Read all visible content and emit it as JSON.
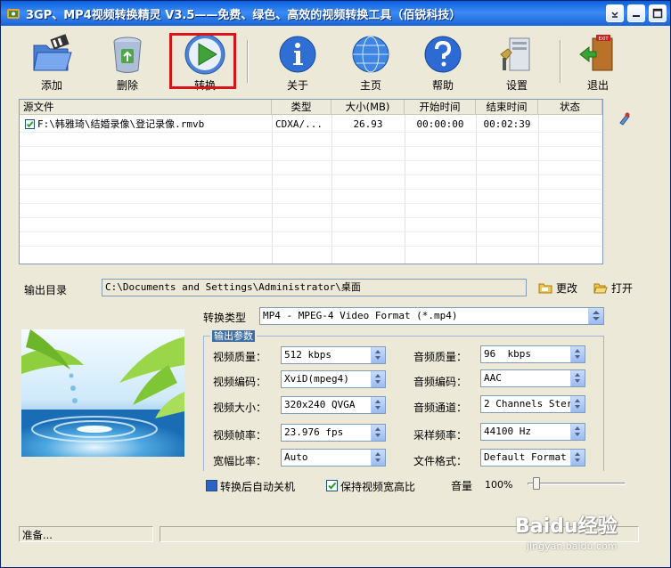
{
  "window": {
    "title": "3GP、MP4视频转换精灵 V3.5——免费、绿色、高效的视频转换工具（佰锐科技）"
  },
  "toolbar": {
    "add": "添加",
    "delete": "删除",
    "convert": "转换",
    "about": "关于",
    "home": "主页",
    "help": "帮助",
    "settings": "设置",
    "exit": "退出"
  },
  "file_table": {
    "headers": [
      "源文件",
      "类型",
      "大小(MB)",
      "开始时间",
      "结束时间",
      "状态"
    ],
    "rows": [
      {
        "checked": true,
        "source": "F:\\韩雅琦\\结婚录像\\登记录像.rmvb",
        "type": "CDXA/...",
        "size": "26.93",
        "start": "00:00:00",
        "end": "00:02:39",
        "status": ""
      }
    ]
  },
  "output": {
    "label": "输出目录",
    "path": "C:\\Documents and Settings\\Administrator\\桌面",
    "change_label": "更改",
    "open_label": "打开"
  },
  "conversion": {
    "type_label": "转换类型",
    "type_value": "MP4 - MPEG-4 Video Format (*.mp4)",
    "group_title": "输出参数",
    "video_quality_label": "视频质量：",
    "video_quality": "512 kbps",
    "video_codec_label": "视频编码：",
    "video_codec": "XviD(mpeg4)",
    "video_size_label": "视频大小：",
    "video_size": "320x240 QVGA",
    "frame_rate_label": "视频帧率：",
    "frame_rate": "23.976 fps",
    "aspect_label": "宽幅比率：",
    "aspect": "Auto",
    "audio_quality_label": "音频质量：",
    "audio_quality": "96  kbps",
    "audio_codec_label": "音频编码：",
    "audio_codec": "AAC",
    "audio_channels_label": "音频通道：",
    "audio_channels": "2 Channels Stere",
    "sample_rate_label": "采样频率：",
    "sample_rate": "44100 Hz",
    "file_format_label": "文件格式：",
    "file_format": "Default Format"
  },
  "options": {
    "auto_shutdown_label": "转换后自动关机",
    "auto_shutdown": false,
    "keep_aspect_label": "保持视频宽高比",
    "keep_aspect": true,
    "volume_label": "音量",
    "volume_value": "100%",
    "volume_level": 1.0
  },
  "statusbar": {
    "text": "准备..."
  },
  "watermark": {
    "text": "Baidu经验",
    "url": "jingyan.baidu.com"
  }
}
